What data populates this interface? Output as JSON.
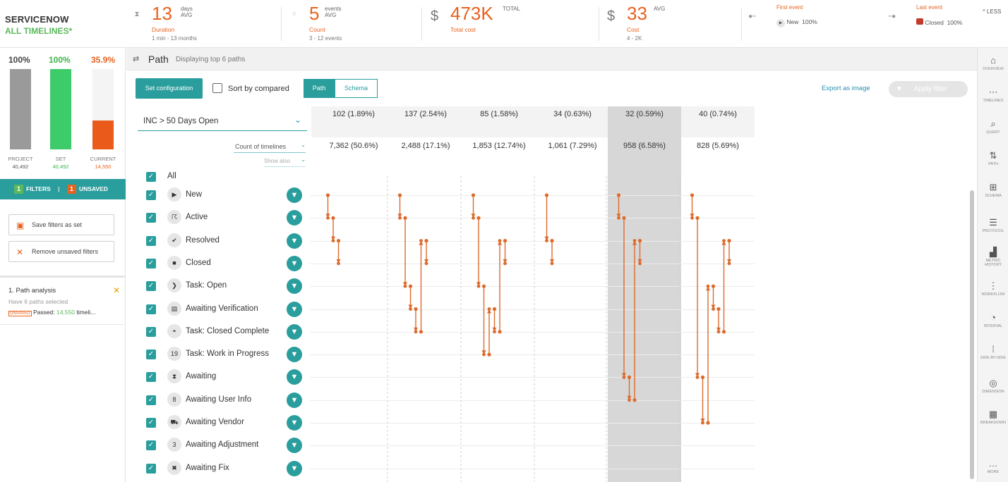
{
  "header": {
    "brand": "SERVICENOW",
    "scope": "ALL TIMELINES*",
    "kpis": [
      {
        "value": "13",
        "sup1": "days",
        "sup2": "AVG",
        "label": "Duration",
        "sub": "1 min - 13 months"
      },
      {
        "value": "5",
        "sup1": "events",
        "sup2": "AVG",
        "label": "Count",
        "sub": "3 - 12 events"
      },
      {
        "currency": "$",
        "value": "473K",
        "sup1": "TOTAL",
        "label": "Total cost"
      },
      {
        "currency": "$",
        "value": "33",
        "sup1": "AVG",
        "label": "Cost",
        "sub": "4 - 2K"
      }
    ],
    "first_event": {
      "label": "First event",
      "value": "New",
      "pct": "100%"
    },
    "last_event": {
      "label": "Last event",
      "value": "Closed",
      "pct": "100%"
    },
    "collapse_label": "^ LESS"
  },
  "left": {
    "bars": [
      {
        "pct": "100%",
        "label": "PROJECT",
        "value": "40,492",
        "fill": 1.0,
        "color": "#9a9a9a",
        "pct_color": "#444"
      },
      {
        "pct": "100%",
        "label": "SET",
        "value": "40,492",
        "fill": 1.0,
        "color": "#3ecb6a",
        "pct_color": "#3ab54a"
      },
      {
        "pct": "35.9%",
        "label": "CURRENT",
        "value": "14,550",
        "fill": 0.359,
        "color": "#ea5a1b",
        "pct_color": "#e8621f"
      }
    ],
    "filters_count": "1",
    "filters_label": "FILTERS",
    "unsaved_count": "1",
    "unsaved_label": "UNSAVED",
    "save_label": "Save filters as set",
    "remove_label": "Remove unsaved filters",
    "analysis": {
      "title": "1. Path analysis",
      "desc": "Have 6 paths selected",
      "badge": "UNSAVED",
      "passed_label": "Passed:",
      "passed_value": "14,550",
      "passed_suffix": "timeli..."
    }
  },
  "toolbar": {
    "title": "Path",
    "subtitle": "Displaying top 6 paths"
  },
  "main": {
    "set_config": "Set configuration",
    "sort_label": "Sort by compared",
    "seg_path": "Path",
    "seg_schema": "Schema",
    "export": "Export as image",
    "apply": "Apply filter",
    "dropdown": "INC > 50 Days Open",
    "count_label": "Count of timelines",
    "show_also": "Show also",
    "all_label": "All",
    "compare_row": [
      "102 (1.89%)",
      "137 (2.54%)",
      "85 (1.58%)",
      "34 (0.63%)",
      "32 (0.59%)",
      "40 (0.74%)"
    ],
    "count_row": [
      "7,362 (50.6%)",
      "2,488 (17.1%)",
      "1,853 (12.74%)",
      "1,061 (7.29%)",
      "958 (6.58%)",
      "828 (5.69%)"
    ],
    "events": [
      {
        "label": "New",
        "icon": "play-icon",
        "glyph": "▶"
      },
      {
        "label": "Active",
        "icon": "runner-icon",
        "glyph": "☈"
      },
      {
        "label": "Resolved",
        "icon": "check-icon",
        "glyph": "✔"
      },
      {
        "label": "Closed",
        "icon": "closed-icon",
        "glyph": "■"
      },
      {
        "label": "Task: Open",
        "icon": "task-open-icon",
        "glyph": "❯"
      },
      {
        "label": "Awaiting Verification",
        "icon": "clipboard-icon",
        "glyph": "▤"
      },
      {
        "label": "Task: Closed Complete",
        "icon": "bell-icon",
        "glyph": "◓"
      },
      {
        "label": "Task: Work in Progress",
        "icon": "number-19-icon",
        "glyph": "19"
      },
      {
        "label": "Awaiting",
        "icon": "hourglass-icon",
        "glyph": "⧗"
      },
      {
        "label": "Awaiting User Info",
        "icon": "number-8-icon",
        "glyph": "8"
      },
      {
        "label": "Awaiting Vendor",
        "icon": "truck-icon",
        "glyph": "⛟"
      },
      {
        "label": "Awaiting Adjustment",
        "icon": "number-3-icon",
        "glyph": "3"
      },
      {
        "label": "Awaiting Fix",
        "icon": "tools-icon",
        "glyph": "✖"
      }
    ],
    "paths": [
      [
        [
          0,
          0
        ],
        [
          0,
          1
        ],
        [
          1,
          1
        ],
        [
          1,
          2
        ],
        [
          2,
          2
        ],
        [
          2,
          3
        ]
      ],
      [
        [
          0,
          0
        ],
        [
          0,
          1
        ],
        [
          1,
          1
        ],
        [
          1,
          4
        ],
        [
          4,
          4
        ],
        [
          4,
          5
        ],
        [
          5,
          5
        ],
        [
          5,
          6
        ],
        [
          6,
          6
        ],
        [
          6,
          2
        ],
        [
          2,
          2
        ],
        [
          2,
          3
        ]
      ],
      [
        [
          0,
          0
        ],
        [
          0,
          1
        ],
        [
          1,
          1
        ],
        [
          1,
          4
        ],
        [
          4,
          4
        ],
        [
          4,
          7
        ],
        [
          7,
          7
        ],
        [
          7,
          5
        ],
        [
          5,
          5
        ],
        [
          5,
          6
        ],
        [
          6,
          6
        ],
        [
          6,
          2
        ],
        [
          2,
          2
        ],
        [
          2,
          3
        ]
      ],
      [
        [
          0,
          0
        ],
        [
          0,
          2
        ],
        [
          2,
          2
        ],
        [
          2,
          3
        ]
      ],
      [
        [
          0,
          0
        ],
        [
          0,
          1
        ],
        [
          1,
          1
        ],
        [
          1,
          8
        ],
        [
          8,
          8
        ],
        [
          8,
          9
        ],
        [
          9,
          9
        ],
        [
          9,
          2
        ],
        [
          2,
          2
        ],
        [
          2,
          3
        ]
      ],
      [
        [
          0,
          0
        ],
        [
          0,
          1
        ],
        [
          1,
          1
        ],
        [
          1,
          8
        ],
        [
          8,
          8
        ],
        [
          8,
          10
        ],
        [
          10,
          10
        ],
        [
          10,
          4
        ],
        [
          4,
          4
        ],
        [
          4,
          5
        ],
        [
          5,
          5
        ],
        [
          5,
          6
        ],
        [
          6,
          6
        ],
        [
          6,
          2
        ],
        [
          2,
          2
        ],
        [
          2,
          3
        ]
      ]
    ],
    "selected_column": 4
  },
  "rnav": [
    {
      "label": "OVERVIEW",
      "icon": "home-icon",
      "glyph": "⌂"
    },
    {
      "label": "TIMELINES",
      "icon": "timelines-icon",
      "glyph": "⋯"
    },
    {
      "label": "QUERY",
      "icon": "query-icon",
      "glyph": "⌕"
    },
    {
      "label": "PATH",
      "icon": "path-icon",
      "glyph": "⇅"
    },
    {
      "label": "SCHEMA",
      "icon": "schema-icon",
      "glyph": "⊞"
    },
    {
      "label": "PROTOCOL",
      "icon": "protocol-icon",
      "glyph": "☰"
    },
    {
      "label": "METRIC HISTORY",
      "icon": "metric-history-icon",
      "glyph": "▟"
    },
    {
      "label": "WORKFLOW",
      "icon": "workflow-icon",
      "glyph": "⋮"
    },
    {
      "label": "INTERVAL",
      "icon": "interval-icon",
      "glyph": "◔"
    },
    {
      "label": "SIDE-BY-SIDE",
      "icon": "side-by-side-icon",
      "glyph": "⁞"
    },
    {
      "label": "DIMENSION",
      "icon": "dimension-icon",
      "glyph": "◎"
    },
    {
      "label": "BREAKDOWN",
      "icon": "breakdown-icon",
      "glyph": "▦"
    },
    {
      "label": "MORE",
      "icon": "more-icon",
      "glyph": "…"
    }
  ],
  "colors": {
    "teal": "#2a9d9d",
    "orange": "#e8621f",
    "green": "#5cb85c",
    "path": "#dd6a2a"
  }
}
